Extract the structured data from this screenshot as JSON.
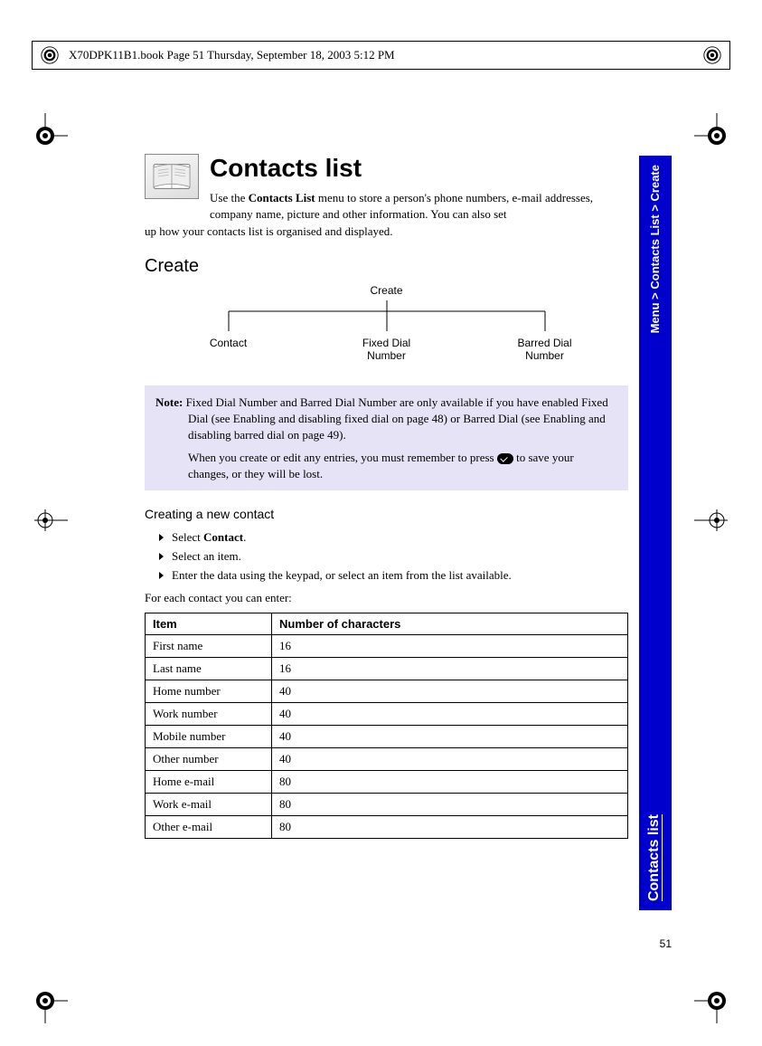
{
  "header": {
    "doc_info": "X70DPK11B1.book  Page 51  Thursday, September 18, 2003  5:12 PM"
  },
  "side_tab": {
    "breadcrumb": "Menu > Contacts List > Create",
    "section": "Contacts list"
  },
  "title": "Contacts list",
  "intro_line1": "Use the ",
  "intro_bold": "Contacts List",
  "intro_line1b": " menu to store a person's phone numbers, e-mail addresses, company name, picture and other information. You can also set",
  "intro_line2": "up how your contacts list is organised and displayed.",
  "create": {
    "heading": "Create",
    "tree_top": "Create",
    "branches": [
      "Contact",
      "Fixed Dial\nNumber",
      "Barred Dial\nNumber"
    ]
  },
  "note": {
    "prefix": "Note:",
    "p1": " Fixed Dial Number and Barred Dial Number are only available if you have enabled Fixed Dial (see Enabling and disabling fixed dial on page 48) or Barred Dial (see Enabling and disabling barred dial on page 49).",
    "p2a": "When you create or edit any entries, you must remember to press ",
    "p2b": " to save your changes, or they will be lost."
  },
  "creating": {
    "heading": "Creating a new contact",
    "steps": [
      {
        "pre": "Select ",
        "bold": "Contact",
        "post": "."
      },
      {
        "pre": "Select an item.",
        "bold": "",
        "post": ""
      },
      {
        "pre": "Enter the data using the keypad, or select an item from the list available.",
        "bold": "",
        "post": ""
      }
    ],
    "after": "For each contact you can enter:"
  },
  "table": {
    "headers": [
      "Item",
      "Number of characters"
    ],
    "rows": [
      [
        "First name",
        "16"
      ],
      [
        "Last name",
        "16"
      ],
      [
        "Home number",
        "40"
      ],
      [
        "Work number",
        "40"
      ],
      [
        "Mobile number",
        "40"
      ],
      [
        "Other number",
        "40"
      ],
      [
        "Home e-mail",
        "80"
      ],
      [
        "Work e-mail",
        "80"
      ],
      [
        "Other e-mail",
        "80"
      ]
    ]
  },
  "page_number": "51"
}
